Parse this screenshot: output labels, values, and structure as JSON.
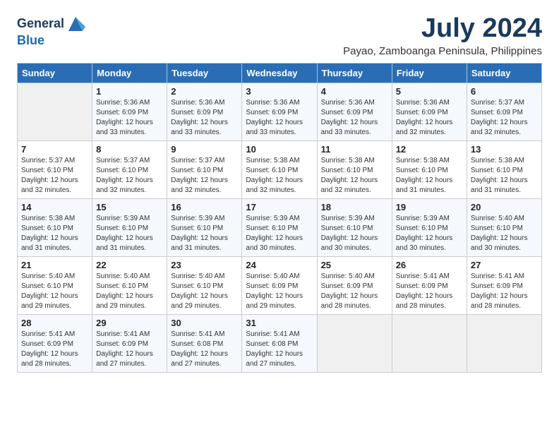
{
  "logo": {
    "line1": "General",
    "line2": "Blue"
  },
  "header": {
    "month_year": "July 2024",
    "location": "Payao, Zamboanga Peninsula, Philippines"
  },
  "days_of_week": [
    "Sunday",
    "Monday",
    "Tuesday",
    "Wednesday",
    "Thursday",
    "Friday",
    "Saturday"
  ],
  "weeks": [
    [
      {
        "day": "",
        "info": ""
      },
      {
        "day": "1",
        "info": "Sunrise: 5:36 AM\nSunset: 6:09 PM\nDaylight: 12 hours\nand 33 minutes."
      },
      {
        "day": "2",
        "info": "Sunrise: 5:36 AM\nSunset: 6:09 PM\nDaylight: 12 hours\nand 33 minutes."
      },
      {
        "day": "3",
        "info": "Sunrise: 5:36 AM\nSunset: 6:09 PM\nDaylight: 12 hours\nand 33 minutes."
      },
      {
        "day": "4",
        "info": "Sunrise: 5:36 AM\nSunset: 6:09 PM\nDaylight: 12 hours\nand 33 minutes."
      },
      {
        "day": "5",
        "info": "Sunrise: 5:36 AM\nSunset: 6:09 PM\nDaylight: 12 hours\nand 32 minutes."
      },
      {
        "day": "6",
        "info": "Sunrise: 5:37 AM\nSunset: 6:09 PM\nDaylight: 12 hours\nand 32 minutes."
      }
    ],
    [
      {
        "day": "7",
        "info": "Sunrise: 5:37 AM\nSunset: 6:10 PM\nDaylight: 12 hours\nand 32 minutes."
      },
      {
        "day": "8",
        "info": "Sunrise: 5:37 AM\nSunset: 6:10 PM\nDaylight: 12 hours\nand 32 minutes."
      },
      {
        "day": "9",
        "info": "Sunrise: 5:37 AM\nSunset: 6:10 PM\nDaylight: 12 hours\nand 32 minutes."
      },
      {
        "day": "10",
        "info": "Sunrise: 5:38 AM\nSunset: 6:10 PM\nDaylight: 12 hours\nand 32 minutes."
      },
      {
        "day": "11",
        "info": "Sunrise: 5:38 AM\nSunset: 6:10 PM\nDaylight: 12 hours\nand 32 minutes."
      },
      {
        "day": "12",
        "info": "Sunrise: 5:38 AM\nSunset: 6:10 PM\nDaylight: 12 hours\nand 31 minutes."
      },
      {
        "day": "13",
        "info": "Sunrise: 5:38 AM\nSunset: 6:10 PM\nDaylight: 12 hours\nand 31 minutes."
      }
    ],
    [
      {
        "day": "14",
        "info": "Sunrise: 5:38 AM\nSunset: 6:10 PM\nDaylight: 12 hours\nand 31 minutes."
      },
      {
        "day": "15",
        "info": "Sunrise: 5:39 AM\nSunset: 6:10 PM\nDaylight: 12 hours\nand 31 minutes."
      },
      {
        "day": "16",
        "info": "Sunrise: 5:39 AM\nSunset: 6:10 PM\nDaylight: 12 hours\nand 31 minutes."
      },
      {
        "day": "17",
        "info": "Sunrise: 5:39 AM\nSunset: 6:10 PM\nDaylight: 12 hours\nand 30 minutes."
      },
      {
        "day": "18",
        "info": "Sunrise: 5:39 AM\nSunset: 6:10 PM\nDaylight: 12 hours\nand 30 minutes."
      },
      {
        "day": "19",
        "info": "Sunrise: 5:39 AM\nSunset: 6:10 PM\nDaylight: 12 hours\nand 30 minutes."
      },
      {
        "day": "20",
        "info": "Sunrise: 5:40 AM\nSunset: 6:10 PM\nDaylight: 12 hours\nand 30 minutes."
      }
    ],
    [
      {
        "day": "21",
        "info": "Sunrise: 5:40 AM\nSunset: 6:10 PM\nDaylight: 12 hours\nand 29 minutes."
      },
      {
        "day": "22",
        "info": "Sunrise: 5:40 AM\nSunset: 6:10 PM\nDaylight: 12 hours\nand 29 minutes."
      },
      {
        "day": "23",
        "info": "Sunrise: 5:40 AM\nSunset: 6:10 PM\nDaylight: 12 hours\nand 29 minutes."
      },
      {
        "day": "24",
        "info": "Sunrise: 5:40 AM\nSunset: 6:09 PM\nDaylight: 12 hours\nand 29 minutes."
      },
      {
        "day": "25",
        "info": "Sunrise: 5:40 AM\nSunset: 6:09 PM\nDaylight: 12 hours\nand 28 minutes."
      },
      {
        "day": "26",
        "info": "Sunrise: 5:41 AM\nSunset: 6:09 PM\nDaylight: 12 hours\nand 28 minutes."
      },
      {
        "day": "27",
        "info": "Sunrise: 5:41 AM\nSunset: 6:09 PM\nDaylight: 12 hours\nand 28 minutes."
      }
    ],
    [
      {
        "day": "28",
        "info": "Sunrise: 5:41 AM\nSunset: 6:09 PM\nDaylight: 12 hours\nand 28 minutes."
      },
      {
        "day": "29",
        "info": "Sunrise: 5:41 AM\nSunset: 6:09 PM\nDaylight: 12 hours\nand 27 minutes."
      },
      {
        "day": "30",
        "info": "Sunrise: 5:41 AM\nSunset: 6:08 PM\nDaylight: 12 hours\nand 27 minutes."
      },
      {
        "day": "31",
        "info": "Sunrise: 5:41 AM\nSunset: 6:08 PM\nDaylight: 12 hours\nand 27 minutes."
      },
      {
        "day": "",
        "info": ""
      },
      {
        "day": "",
        "info": ""
      },
      {
        "day": "",
        "info": ""
      }
    ]
  ]
}
